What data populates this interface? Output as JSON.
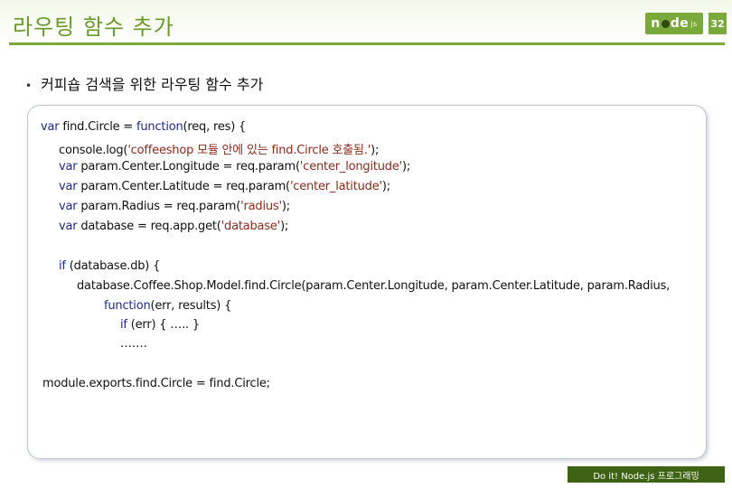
{
  "slide": {
    "title": "라우팅 함수 추가",
    "page_number": "32",
    "logo": {
      "text_n": "n",
      "text_de": "de",
      "text_js": "js"
    },
    "bullet": "커피숍 검색을 위한 라우팅 함수 추가",
    "footer": "Do it! Node.js 프로그래밍"
  },
  "code": {
    "l1": {
      "a": "var",
      "b": " find.Circle = ",
      "c": "function",
      "d": "(req, res) {"
    },
    "l2": {
      "a": "console.log(",
      "b": "'coffeeshop 모듈 안에 있는 find.Circle 호출됨.'",
      "c": ");"
    },
    "l3": {
      "a": "var",
      "b": " param.Center.Longitude = req.param(",
      "c": "'center_longitude'",
      "d": ");"
    },
    "l4": {
      "a": "var",
      "b": " param.Center.Latitude = req.param(",
      "c": "'center_latitude'",
      "d": ");"
    },
    "l5": {
      "a": "var",
      "b": " param.Radius = req.param(",
      "c": "'radius'",
      "d": ");"
    },
    "l6": {
      "a": "var",
      "b": " database = req.app.get(",
      "c": "'database'",
      "d": ");"
    },
    "l7": {
      "a": "if",
      "b": " (database.db) {"
    },
    "l8": {
      "a": "database.Coffee.Shop.Model.find.Circle(param.Center.Longitude, param.Center.Latitude, param.Radius,"
    },
    "l9": {
      "a": "function",
      "b": "(err, results) {"
    },
    "l10": {
      "a": "if",
      "b": " (err) { ….. }"
    },
    "l11": {
      "a": "……."
    },
    "l12": {
      "a": "module.exports.find.Circle = find.Circle;"
    }
  }
}
